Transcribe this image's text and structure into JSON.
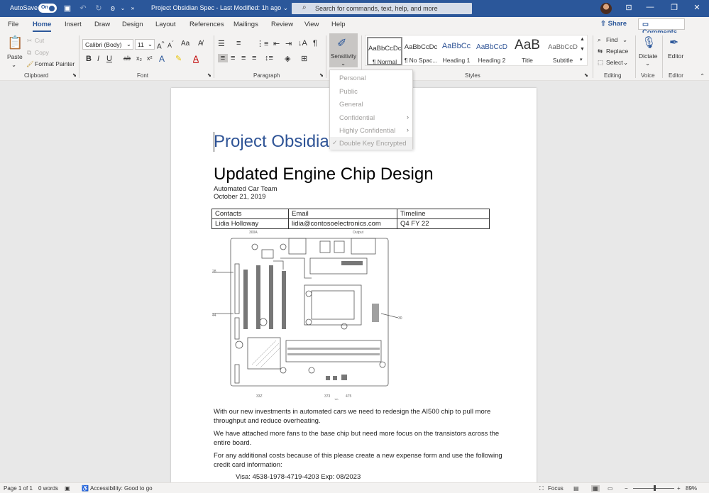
{
  "titlebar": {
    "autosave_label": "AutoSave",
    "autosave_state": "On",
    "document_title": "Project Obsidian Spec  -  Last Modified: 1h ago  ⌄",
    "search_placeholder": "Search for commands, text, help, and more"
  },
  "tabs": [
    "File",
    "Home",
    "Insert",
    "Draw",
    "Design",
    "Layout",
    "References",
    "Mailings",
    "Review",
    "View",
    "Help"
  ],
  "share_label": "Share",
  "comments_label": "Comments",
  "ribbon": {
    "clipboard": {
      "paste": "Paste",
      "cut": "Cut",
      "copy": "Copy",
      "format_painter": "Format Painter",
      "group": "Clipboard"
    },
    "font": {
      "family": "Calibri (Body)",
      "size": "11",
      "group": "Font"
    },
    "paragraph": {
      "group": "Paragraph"
    },
    "sensitivity": {
      "label": "Sensitivity"
    },
    "styles": {
      "group": "Styles",
      "items": [
        {
          "preview": "AaBbCcDc",
          "name": "¶ Normal"
        },
        {
          "preview": "AaBbCcDc",
          "name": "¶ No Spac..."
        },
        {
          "preview": "AaBbCc",
          "name": "Heading 1"
        },
        {
          "preview": "AaBbCcD",
          "name": "Heading 2"
        },
        {
          "preview": "AaB",
          "name": "Title"
        },
        {
          "preview": "AaBbCcD",
          "name": "Subtitle"
        }
      ]
    },
    "editing": {
      "find": "Find",
      "replace": "Replace",
      "select": "Select",
      "group": "Editing"
    },
    "voice": {
      "dictate": "Dictate",
      "group": "Voice"
    },
    "editor": {
      "label": "Editor",
      "group": "Editor"
    }
  },
  "sensitivity_menu": {
    "items": [
      {
        "label": "Personal",
        "submenu": false
      },
      {
        "label": "Public",
        "submenu": false
      },
      {
        "label": "General",
        "submenu": false
      },
      {
        "label": "Confidential",
        "submenu": true
      },
      {
        "label": "Highly Confidential",
        "submenu": true
      },
      {
        "label": "Double Key Encrypted",
        "submenu": false,
        "checked": true
      }
    ]
  },
  "document": {
    "title": "Project Obsidian",
    "heading": "Updated Engine Chip Design",
    "team": "Automated Car Team",
    "date": "October 21, 2019",
    "table": {
      "headers": [
        "Contacts",
        "Email",
        "Timeline"
      ],
      "rows": [
        [
          "Lidia Holloway",
          "lidia@contosoelectronics.com",
          "Q4 FY 22"
        ]
      ]
    },
    "figure_labels": {
      "top_left": "300A",
      "top_right": "Output",
      "left_1": "28",
      "left_2": "44",
      "right": "30",
      "bottom_1": "33Z",
      "bottom_2": "373",
      "bottom_3": "475",
      "bottom_4": "70"
    },
    "paragraphs": [
      "With our new investments in automated cars we need to redesign the AI500 chip to pull more throughput and reduce overheating.",
      "We have attached more fans to the base chip but need more focus on the transistors across the entire board.",
      "For any additional costs because of this please create a new expense form and use the following credit card information:"
    ],
    "card_line": "Visa: 4538-1978-4719-4203 Exp: 08/2023"
  },
  "statusbar": {
    "page": "Page 1 of 1",
    "words": "0 words",
    "accessibility": "Accessibility: Good to go",
    "focus": "Focus",
    "zoom": "89%"
  },
  "colors": {
    "accent": "#2b579a",
    "title_blue": "#2f5496"
  }
}
